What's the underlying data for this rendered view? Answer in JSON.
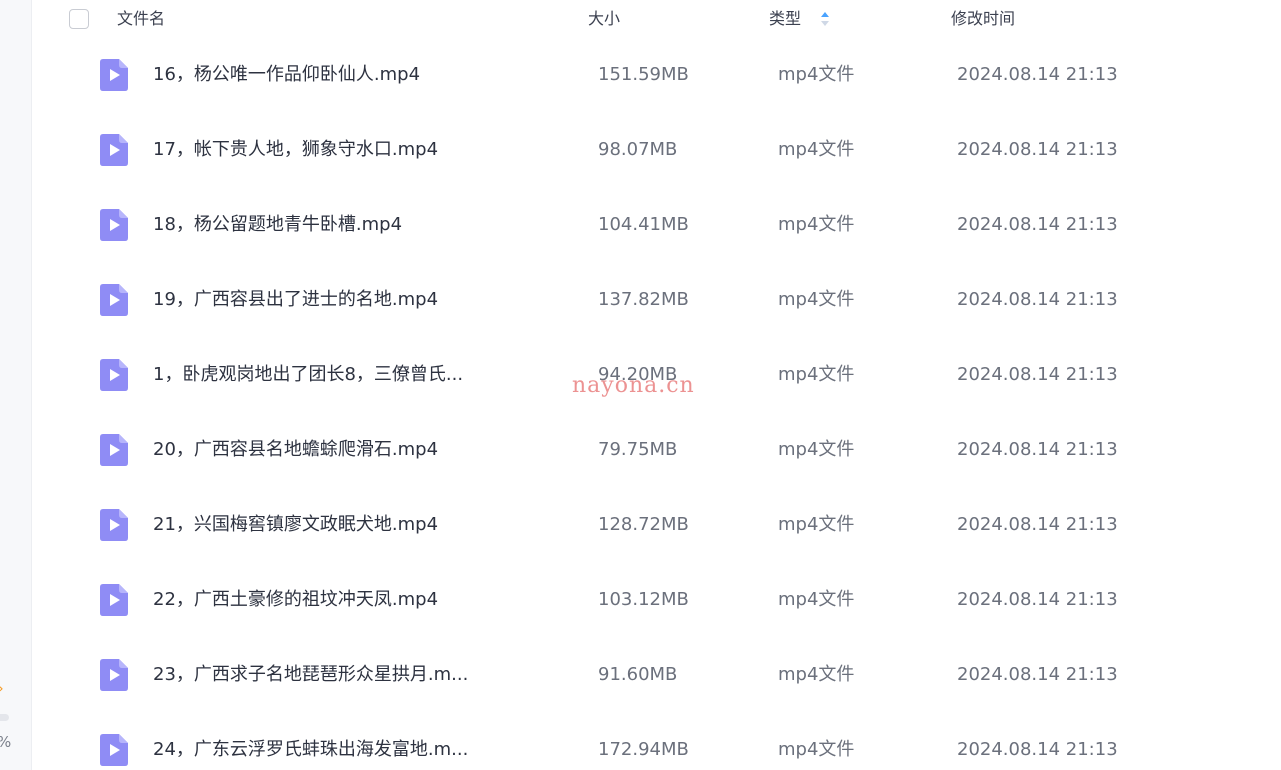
{
  "header": {
    "name_label": "文件名",
    "size_label": "大小",
    "type_label": "类型",
    "time_label": "修改时间"
  },
  "rows": [
    {
      "name": "16，杨公唯一作品仰卧仙人.mp4",
      "size": "151.59MB",
      "type": "mp4文件",
      "time": "2024.08.14 21:13"
    },
    {
      "name": "17，帐下贵人地，狮象守水口.mp4",
      "size": "98.07MB",
      "type": "mp4文件",
      "time": "2024.08.14 21:13"
    },
    {
      "name": "18，杨公留题地青牛卧槽.mp4",
      "size": "104.41MB",
      "type": "mp4文件",
      "time": "2024.08.14 21:13"
    },
    {
      "name": "19，广西容县出了进士的名地.mp4",
      "size": "137.82MB",
      "type": "mp4文件",
      "time": "2024.08.14 21:13"
    },
    {
      "name": "1，卧虎观岗地出了团长8，三僚曾氏...",
      "size": "94.20MB",
      "type": "mp4文件",
      "time": "2024.08.14 21:13"
    },
    {
      "name": "20，广西容县名地蟾蜍爬滑石.mp4",
      "size": "79.75MB",
      "type": "mp4文件",
      "time": "2024.08.14 21:13"
    },
    {
      "name": "21，兴国梅窖镇廖文政眠犬地.mp4",
      "size": "128.72MB",
      "type": "mp4文件",
      "time": "2024.08.14 21:13"
    },
    {
      "name": "22，广西土豪修的祖坟冲天凤.mp4",
      "size": "103.12MB",
      "type": "mp4文件",
      "time": "2024.08.14 21:13"
    },
    {
      "name": "23，广西求子名地琵琶形众星拱月.m...",
      "size": "91.60MB",
      "type": "mp4文件",
      "time": "2024.08.14 21:13"
    },
    {
      "name": "24，广东云浮罗氏蚌珠出海发富地.m...",
      "size": "172.94MB",
      "type": "mp4文件",
      "time": "2024.08.14 21:13"
    }
  ],
  "watermark": "nayona.cn",
  "rail": {
    "percent_text": "%"
  },
  "icons": {
    "file": "video-file-icon",
    "sort": "sort-icon",
    "rail_arrow": "chevron-right-icon"
  },
  "colors": {
    "file_icon": "#8f8cf5",
    "sort_active": "#4aa3ff",
    "watermark": "#e66e6e"
  }
}
